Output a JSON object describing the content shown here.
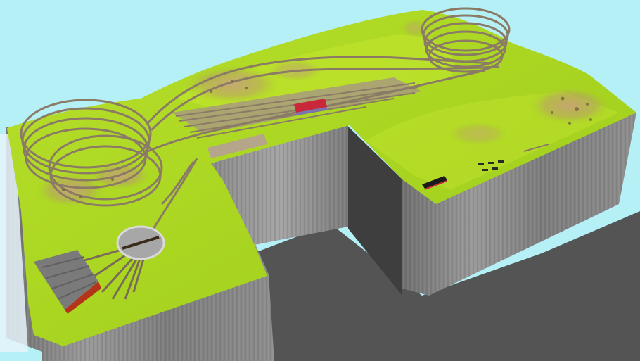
{
  "scene": {
    "sky_color": "#b5f0f7",
    "floor_color": "#545454",
    "terrain_top_color": "#a6d41c",
    "terrain_light_color": "#c4e830",
    "cliff_color": "#7f7f7f",
    "track_color": "#8a7a66",
    "building_roof_color": "#7a7a7a",
    "building_wall_color": "#b3341a",
    "carriage_color": "#c8283a",
    "locomotive_color": "#1a1a1a"
  }
}
